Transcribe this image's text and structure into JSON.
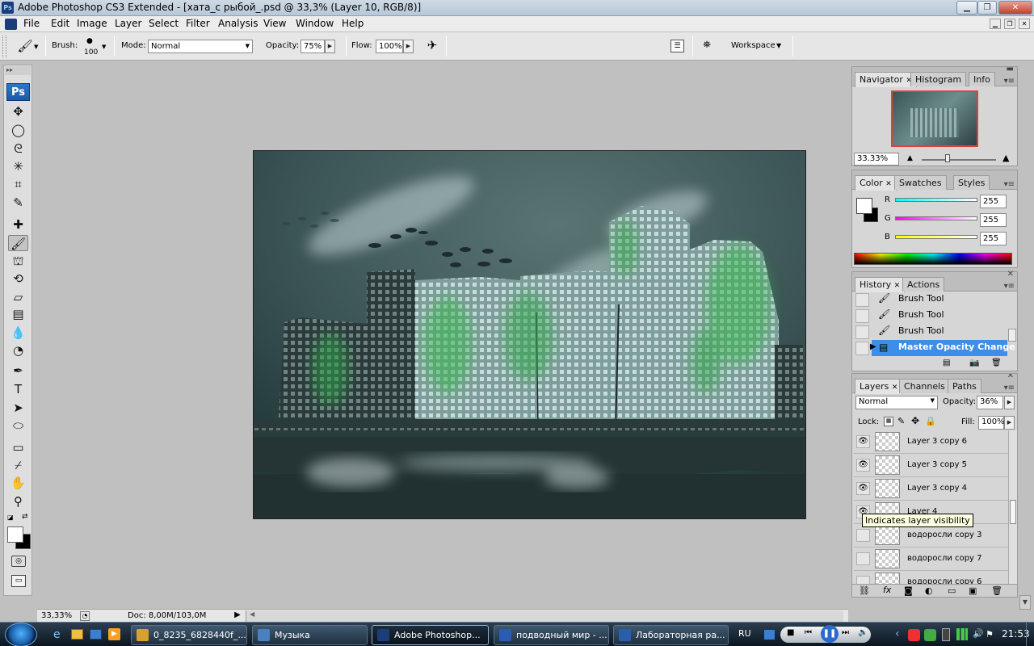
{
  "window": {
    "title": "Adobe Photoshop CS3 Extended - [хата_с рыбой_.psd @ 33,3% (Layer 10, RGB/8)]",
    "app_icon": "Ps"
  },
  "menu": [
    "File",
    "Edit",
    "Image",
    "Layer",
    "Select",
    "Filter",
    "Analysis",
    "View",
    "Window",
    "Help"
  ],
  "options": {
    "brush_label": "Brush:",
    "brush_size": "100",
    "mode_label": "Mode:",
    "mode_value": "Normal",
    "opacity_label": "Opacity:",
    "opacity_value": "75%",
    "flow_label": "Flow:",
    "flow_value": "100%",
    "workspace_label": "Workspace"
  },
  "toolbox": {
    "logo": "Ps",
    "tools": [
      {
        "name": "move-tool-icon",
        "glyph": "✥"
      },
      {
        "name": "ellipse-marquee-icon",
        "glyph": "◯"
      },
      {
        "name": "lasso-tool-icon",
        "glyph": "ᘓ"
      },
      {
        "name": "magic-wand-icon",
        "glyph": "✳"
      },
      {
        "name": "crop-tool-icon",
        "glyph": "⌗"
      },
      {
        "name": "slice-tool-icon",
        "glyph": "✎"
      },
      {
        "name": "healing-brush-icon",
        "glyph": "✚"
      },
      {
        "name": "brush-tool-icon",
        "glyph": "🖌",
        "selected": true
      },
      {
        "name": "clone-stamp-icon",
        "glyph": "⛫"
      },
      {
        "name": "history-brush-icon",
        "glyph": "⟲"
      },
      {
        "name": "eraser-tool-icon",
        "glyph": "▱"
      },
      {
        "name": "gradient-tool-icon",
        "glyph": "▤"
      },
      {
        "name": "blur-tool-icon",
        "glyph": "💧"
      },
      {
        "name": "dodge-tool-icon",
        "glyph": "◔"
      },
      {
        "name": "pen-tool-icon",
        "glyph": "✒"
      },
      {
        "name": "type-tool-icon",
        "glyph": "T"
      },
      {
        "name": "path-selection-icon",
        "glyph": "➤"
      },
      {
        "name": "shape-tool-icon",
        "glyph": "⬭"
      },
      {
        "name": "notes-tool-icon",
        "glyph": "▭"
      },
      {
        "name": "eyedropper-icon",
        "glyph": "⌿"
      },
      {
        "name": "hand-tool-icon",
        "glyph": "✋"
      },
      {
        "name": "zoom-tool-icon",
        "glyph": "⚲"
      }
    ]
  },
  "navigator": {
    "tabs": [
      "Navigator",
      "Histogram",
      "Info"
    ],
    "zoom": "33.33%"
  },
  "color": {
    "tabs": [
      "Color",
      "Swatches",
      "Styles"
    ],
    "r_label": "R",
    "g_label": "G",
    "b_label": "B",
    "r": "255",
    "g": "255",
    "b": "255"
  },
  "history": {
    "tabs": [
      "History",
      "Actions"
    ],
    "items": [
      "Brush Tool",
      "Brush Tool",
      "Brush Tool",
      "Master Opacity Change"
    ]
  },
  "layers": {
    "tabs": [
      "Layers",
      "Channels",
      "Paths"
    ],
    "blend_mode": "Normal",
    "opacity_label": "Opacity:",
    "opacity": "36%",
    "lock_label": "Lock:",
    "fill_label": "Fill:",
    "fill": "100%",
    "items": [
      {
        "name": "Layer 3 copy 6",
        "visible": true
      },
      {
        "name": "Layer 3 copy 5",
        "visible": true
      },
      {
        "name": "Layer 3 copy 4",
        "visible": true
      },
      {
        "name": "Layer 4",
        "visible": true
      },
      {
        "name": "водоросли copy 3",
        "visible": false
      },
      {
        "name": "водоросли copy 7",
        "visible": false
      },
      {
        "name": "водоросли copy 6",
        "visible": false
      }
    ],
    "tooltip": "Indicates layer visibility"
  },
  "status": {
    "zoom": "33,33%",
    "doc": "Doc: 8,00M/103,0M"
  },
  "taskbar": {
    "items": [
      {
        "label": "0_8235_6828440f_...",
        "color": "#d8a030"
      },
      {
        "label": "Музыка",
        "color": "#4a7fc0"
      },
      {
        "label": "Adobe Photoshop...",
        "color": "#1b3d7a",
        "active": true
      },
      {
        "label": "подводный мир - ...",
        "color": "#2a5db0"
      },
      {
        "label": "Лабораторная ра...",
        "color": "#2a5db0"
      }
    ],
    "lang": "RU",
    "clock": "21:53"
  }
}
